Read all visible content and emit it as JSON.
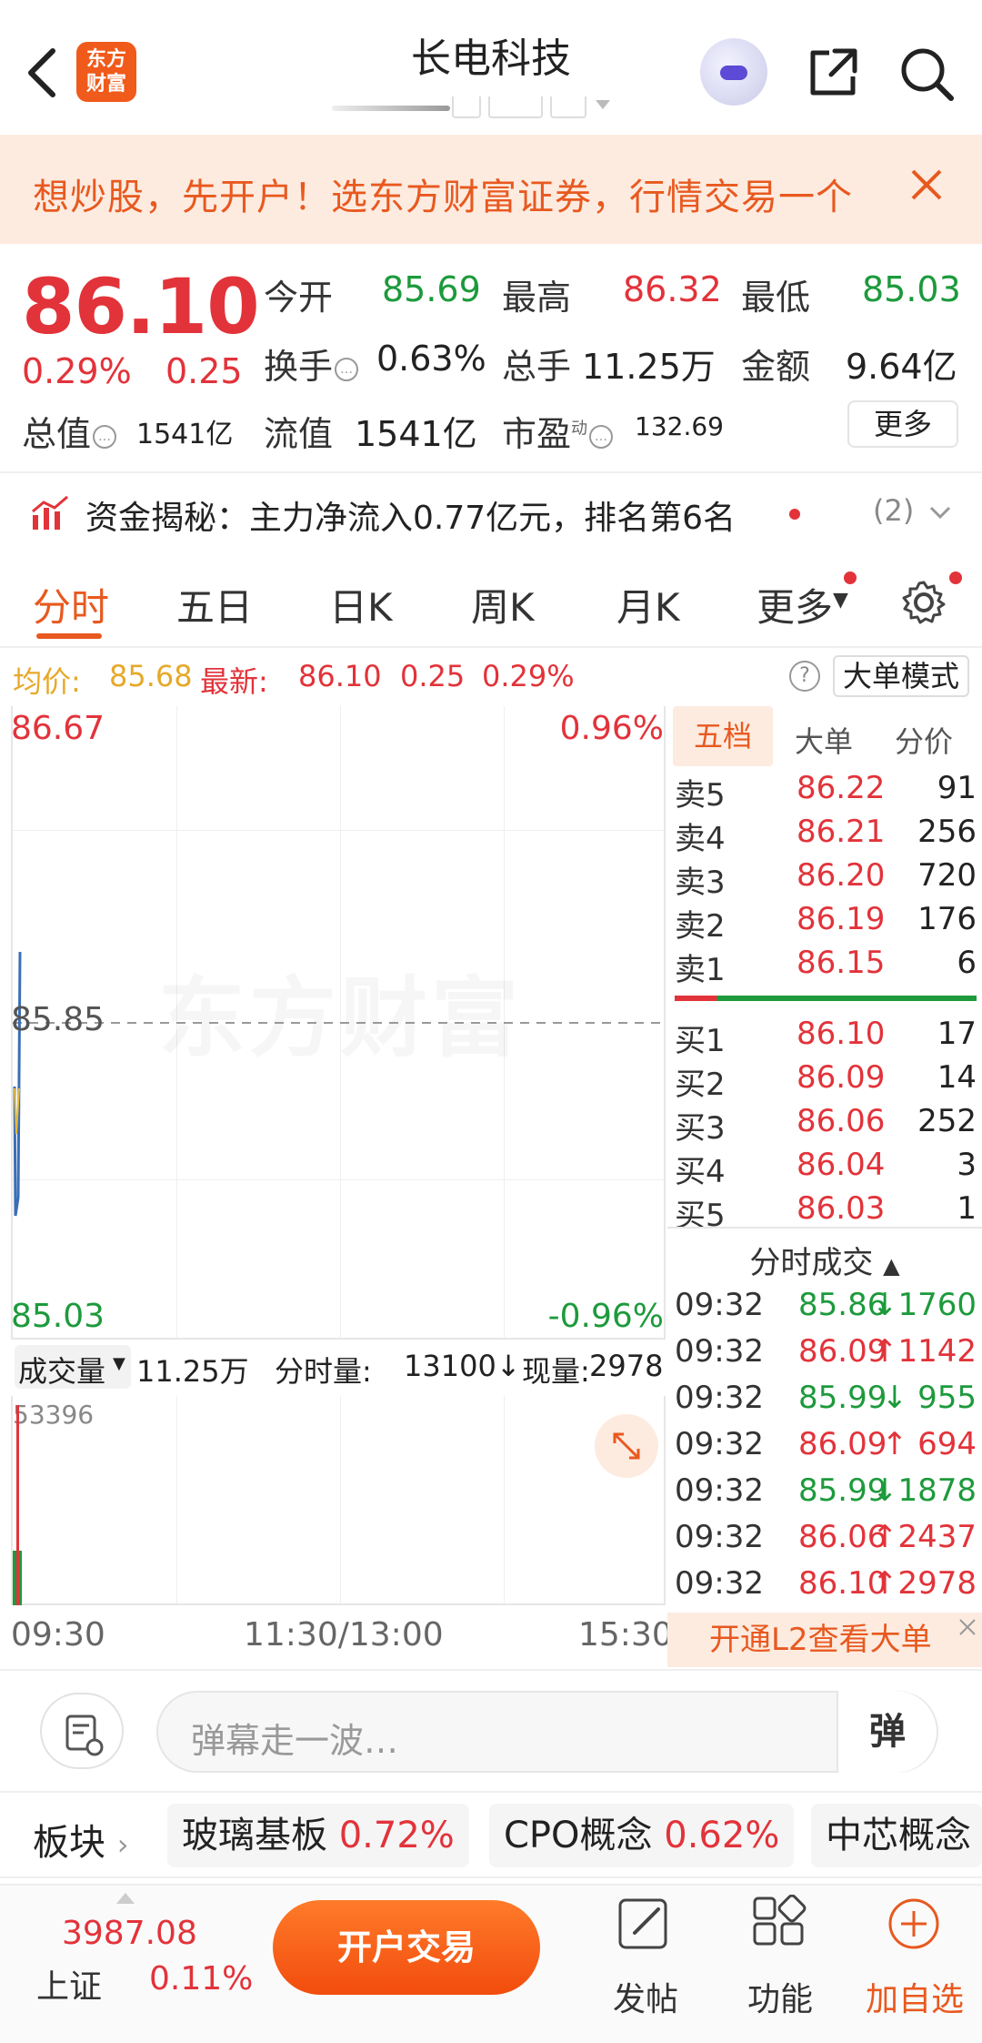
{
  "header": {
    "title": "长电科技",
    "logo_text_line1": "东方",
    "logo_text_line2": "财富"
  },
  "banner": {
    "text": "想炒股，先开户！选东方财富证券，行情交易一个"
  },
  "quote": {
    "price": "86.10",
    "change_pct": "0.29%",
    "change": "0.25",
    "open_label": "今开",
    "open": "85.69",
    "high_label": "最高",
    "high": "86.32",
    "low_label": "最低",
    "low": "85.03",
    "turnover_label": "换手",
    "turnover": "0.63%",
    "volume_label": "总手",
    "volume": "11.25万",
    "amount_label": "金额",
    "amount": "9.64亿",
    "mktcap_label": "总值",
    "mktcap": "1541亿",
    "float_label": "流值",
    "float_cap": "1541亿",
    "pe_label": "市盈",
    "pe_sup": "动",
    "pe": "132.69",
    "more_label": "更多"
  },
  "fund_flow": {
    "text": "资金揭秘：主力净流入0.77亿元，排名第6名",
    "count": "(2)"
  },
  "tabs": [
    {
      "label": "分时"
    },
    {
      "label": "五日"
    },
    {
      "label": "日K"
    },
    {
      "label": "周K"
    },
    {
      "label": "月K"
    },
    {
      "label": "更多"
    }
  ],
  "avg_row": {
    "avg_label": "均价:",
    "avg": "85.68",
    "latest_label": "最新:",
    "latest": "86.10",
    "chg": "0.25",
    "pct": "0.29%",
    "help": "?",
    "mode_label": "大单模式"
  },
  "chart": {
    "max_price": "86.67",
    "max_pct": "0.96%",
    "mid_price": "85.85",
    "min_price": "85.03",
    "min_pct": "-0.96%",
    "watermark": "东方财富",
    "time_start": "09:30",
    "time_mid": "11:30/13:00",
    "time_end": "15:30",
    "colors": {
      "up": "#e2333a",
      "down": "#1d9a3c",
      "price_line": "#3a6fb5",
      "avg_line": "#e6b93a"
    }
  },
  "volume": {
    "selector": "成交量",
    "total": "11.25万",
    "minute_label": "分时量:",
    "minute": "13100↓",
    "now_label": "现量:",
    "now": "2978",
    "max": "53396"
  },
  "order_book": {
    "tabs": [
      "五档",
      "大单",
      "分价"
    ],
    "asks": [
      {
        "label": "卖5",
        "price": "86.22",
        "qty": "91"
      },
      {
        "label": "卖4",
        "price": "86.21",
        "qty": "256"
      },
      {
        "label": "卖3",
        "price": "86.20",
        "qty": "720"
      },
      {
        "label": "卖2",
        "price": "86.19",
        "qty": "176"
      },
      {
        "label": "卖1",
        "price": "86.15",
        "qty": "6"
      }
    ],
    "bids": [
      {
        "label": "买1",
        "price": "86.10",
        "qty": "17"
      },
      {
        "label": "买2",
        "price": "86.09",
        "qty": "14"
      },
      {
        "label": "买3",
        "price": "86.06",
        "qty": "252"
      },
      {
        "label": "买4",
        "price": "86.04",
        "qty": "3"
      },
      {
        "label": "买5",
        "price": "86.03",
        "qty": "1"
      }
    ],
    "trades_title": "分时成交",
    "trades": [
      {
        "time": "09:32",
        "price": "85.86",
        "arrow": "↓",
        "vol": "1760",
        "dir": "down"
      },
      {
        "time": "09:32",
        "price": "86.09",
        "arrow": "↑",
        "vol": "1142",
        "dir": "up"
      },
      {
        "time": "09:32",
        "price": "85.99",
        "arrow": "↓",
        "vol": "955",
        "dir": "down"
      },
      {
        "time": "09:32",
        "price": "86.09",
        "arrow": "↑",
        "vol": "694",
        "dir": "up"
      },
      {
        "time": "09:32",
        "price": "85.99",
        "arrow": "↓",
        "vol": "1878",
        "dir": "down"
      },
      {
        "time": "09:32",
        "price": "86.06",
        "arrow": "↑",
        "vol": "2437",
        "dir": "up"
      },
      {
        "time": "09:32",
        "price": "86.10",
        "arrow": "↑",
        "vol": "2978",
        "dir": "up"
      }
    ],
    "l2_label": "开通L2查看大单"
  },
  "comment": {
    "placeholder": "弹幕走一波…",
    "danmu_button": "弹"
  },
  "sectors": {
    "label": "板块",
    "items": [
      {
        "name": "玻璃基板",
        "pct": "0.72%"
      },
      {
        "name": "CPO概念",
        "pct": "0.62%"
      },
      {
        "name": "中芯概念",
        "pct": ""
      }
    ]
  },
  "bottom": {
    "index_value": "3987.08",
    "index_name": "上证",
    "index_change": "0.11%",
    "trade_button": "开户交易",
    "nav": [
      {
        "label": "发帖"
      },
      {
        "label": "功能"
      },
      {
        "label": "加自选"
      }
    ]
  }
}
